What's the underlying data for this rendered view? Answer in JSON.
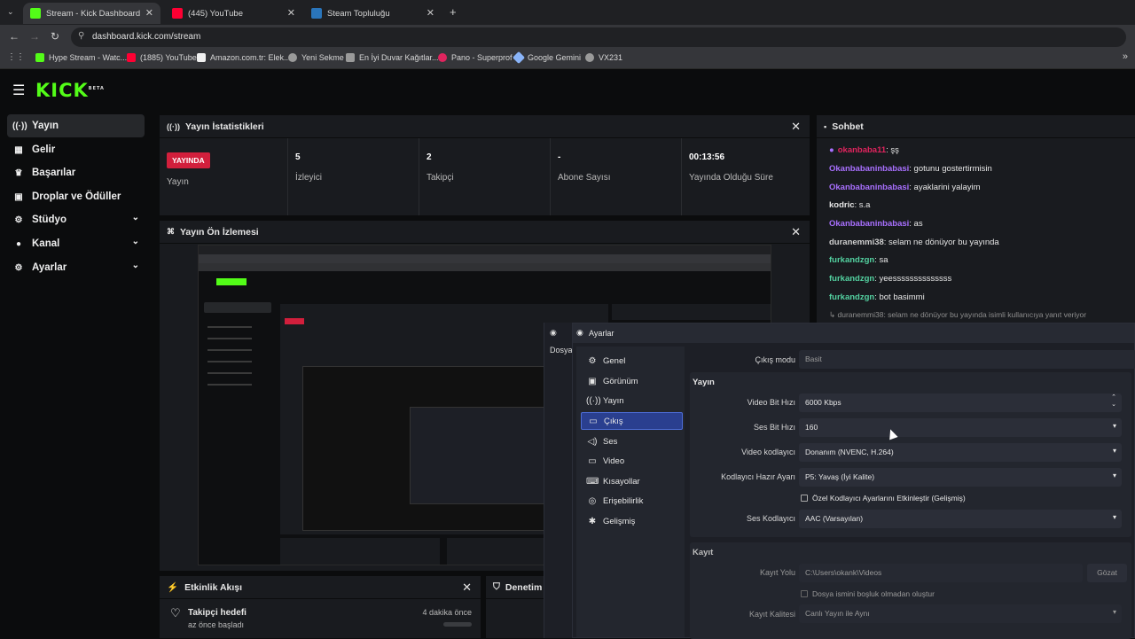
{
  "browser": {
    "tabs": [
      {
        "label": "Stream - Kick Dashboard",
        "color": "#53fc18"
      },
      {
        "label": "(445) YouTube",
        "color": "#ff0033"
      },
      {
        "label": "Steam Topluluğu",
        "color": "#2a75bb"
      }
    ],
    "url": "dashboard.kick.com/stream",
    "bookmarks": [
      {
        "label": "Hype Stream - Watc...",
        "color": "#53fc18"
      },
      {
        "label": "(1885) YouTube",
        "color": "#ff0033"
      },
      {
        "label": "Amazon.com.tr: Elek...",
        "color": "#f0f0f0"
      },
      {
        "label": "Yeni Sekme",
        "color": "#9a9a9a"
      },
      {
        "label": "En İyi Duvar Kağıtlar...",
        "color": "#9a9a9a"
      },
      {
        "label": "Pano - Superprof",
        "color": "#e0245e"
      },
      {
        "label": "Google Gemini",
        "color": "#8ab4f8"
      },
      {
        "label": "VX231",
        "color": "#9a9a9a"
      }
    ]
  },
  "kick": {
    "logo": "KICK",
    "logo_tag": "BETA",
    "sidebar": [
      {
        "label": "Yayın",
        "icon": "((·))"
      },
      {
        "label": "Gelir",
        "icon": "▦"
      },
      {
        "label": "Başarılar",
        "icon": "🏆"
      },
      {
        "label": "Droplar ve Ödüller",
        "icon": "▣"
      },
      {
        "label": "Stüdyo",
        "icon": "⚙"
      },
      {
        "label": "Kanal",
        "icon": "👤"
      },
      {
        "label": "Ayarlar",
        "icon": "⚙"
      }
    ],
    "stats_panel": {
      "title": "Yayın İstatistikleri",
      "stats": [
        {
          "value": "YAYINDA",
          "label": "Yayın"
        },
        {
          "value": "5",
          "label": "İzleyici"
        },
        {
          "value": "2",
          "label": "Takipçi"
        },
        {
          "value": "-",
          "label": "Abone Sayısı"
        },
        {
          "value": "00:13:56",
          "label": "Yayında Olduğu Süre"
        }
      ]
    },
    "preview_panel": {
      "title": "Yayın Ön İzlemesi"
    },
    "activity_panel": {
      "title": "Etkinlik Akışı",
      "item_title": "Takipçi hedefi",
      "item_sub": "az önce başladı",
      "item_time": "4 dakika önce"
    },
    "mod_panel": {
      "title": "Denetim"
    },
    "chat": {
      "title": "Sohbet",
      "messages": [
        {
          "user": "okanbaba11",
          "text": ": şş",
          "color": "#e0245e"
        },
        {
          "user": "Okanbabaninbabasi",
          "text": ": gotunu gostertirmisin",
          "color": "#a970ff"
        },
        {
          "user": "Okanbabaninbabasi",
          "text": ": ayaklarini yalayim",
          "color": "#a970ff"
        },
        {
          "user": "kodric",
          "text": ": s.a",
          "color": "#e6e6e6"
        },
        {
          "user": "Okanbabaninbabasi",
          "text": ": as",
          "color": "#a970ff"
        },
        {
          "user": "duranemmi38",
          "text": ": selam ne dönüyor bu yayında",
          "color": "#cfcfcf"
        },
        {
          "user": "furkandzgn",
          "text": ": sa",
          "color": "#53d1a0"
        },
        {
          "user": "furkandzgn",
          "text": ": yeessssssssssssss",
          "color": "#53d1a0"
        },
        {
          "user": "furkandzgn",
          "text": ": bot basimmi",
          "color": "#53d1a0"
        }
      ],
      "reply": "↳ duranemmi38: selam ne dönüyor bu yayında isimli kullanıcıya yanıt veriyor"
    }
  },
  "obs": {
    "title": "Ayarlar",
    "behind_text": "Dosya",
    "nav": [
      "Genel",
      "Görünüm",
      "Yayın",
      "Çıkış",
      "Ses",
      "Video",
      "Kısayollar",
      "Erişebilirlik",
      "Gelişmiş"
    ],
    "nav_icons": [
      "⚙",
      "▣",
      "((·))",
      "▭",
      "◁)",
      "▭",
      "⌨",
      "◎",
      "✱"
    ],
    "output_mode_label": "Çıkış modu",
    "output_mode": "Basit",
    "stream_section": "Yayın",
    "fields": [
      {
        "label": "Video Bit Hızı",
        "value": "6000 Kbps"
      },
      {
        "label": "Ses Bit Hızı",
        "value": "160"
      },
      {
        "label": "Video kodlayıcı",
        "value": "Donanım (NVENC, H.264)"
      },
      {
        "label": "Kodlayıcı Hazır Ayarı",
        "value": "P5: Yavaş (İyi Kalite)"
      }
    ],
    "custom_encoder": "Özel Kodlayıcı Ayarlarını Etkinleştir (Gelişmiş)",
    "audio_encoder_label": "Ses Kodlayıcı",
    "audio_encoder": "AAC (Varsayılan)",
    "record_section": "Kayıt",
    "record_path_label": "Kayıt Yolu",
    "record_path": "C:\\Users\\okank\\Videos",
    "browse": "Gözat",
    "no_space": "Dosya ismini boşluk olmadan oluştur",
    "record_quality_label": "Kayıt Kalitesi",
    "record_quality": "Canlı Yayın ile Aynı"
  }
}
